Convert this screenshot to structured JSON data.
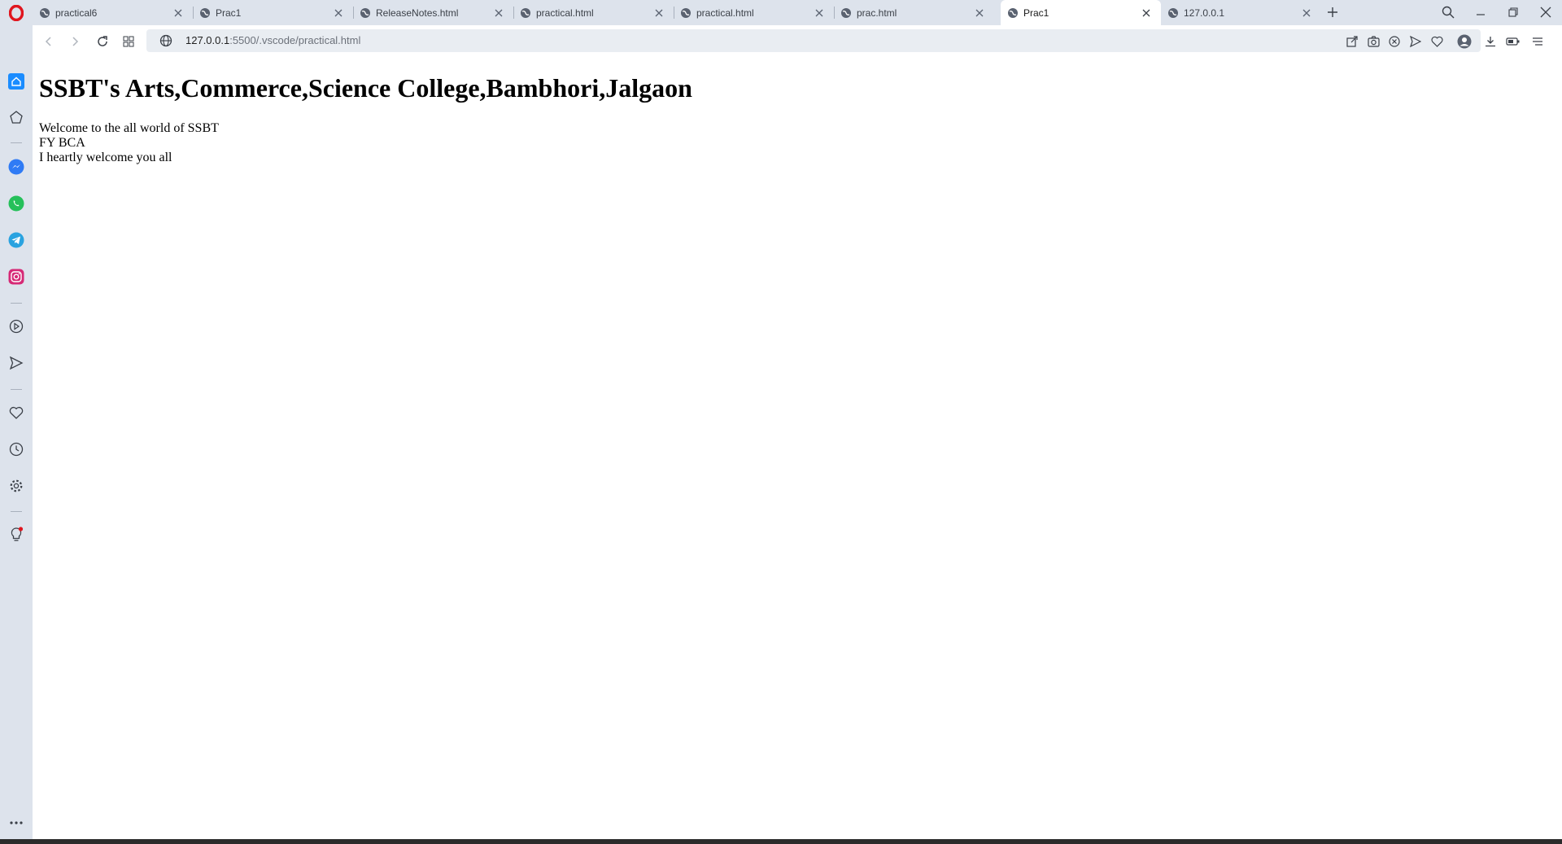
{
  "tabs": [
    {
      "label": "practical6",
      "active": false
    },
    {
      "label": "Prac1",
      "active": false
    },
    {
      "label": "ReleaseNotes.html",
      "active": false
    },
    {
      "label": "practical.html",
      "active": false
    },
    {
      "label": "practical.html",
      "active": false
    },
    {
      "label": "prac.html",
      "active": false
    },
    {
      "label": "Prac1",
      "active": true
    },
    {
      "label": "127.0.0.1",
      "active": false
    }
  ],
  "address_bar": {
    "host": "127.0.0.1",
    "path": ":5500/.vscode/practical.html"
  },
  "page": {
    "heading": "SSBT's Arts,Commerce,Science College,Bambhori,Jalgaon",
    "lines": [
      "Welcome to the all world of SSBT",
      "FY BCA",
      "I heartly welcome you all"
    ]
  },
  "sidebar": {
    "items": [
      "home-icon",
      "pinboard-icon",
      "messenger-icon",
      "whatsapp-icon",
      "telegram-icon",
      "instagram-icon",
      "player-icon",
      "flow-icon",
      "bookmarks-icon",
      "history-icon",
      "settings-icon",
      "tips-icon",
      "more-icon"
    ]
  },
  "colors": {
    "opera_red": "#e0161f",
    "sidebar_bg": "#dde3ec",
    "home_blue": "#1a8cff",
    "messenger": "#2f7bf5",
    "whatsapp": "#25c05a",
    "telegram": "#2aa3e0",
    "instagram": "#d62976"
  }
}
